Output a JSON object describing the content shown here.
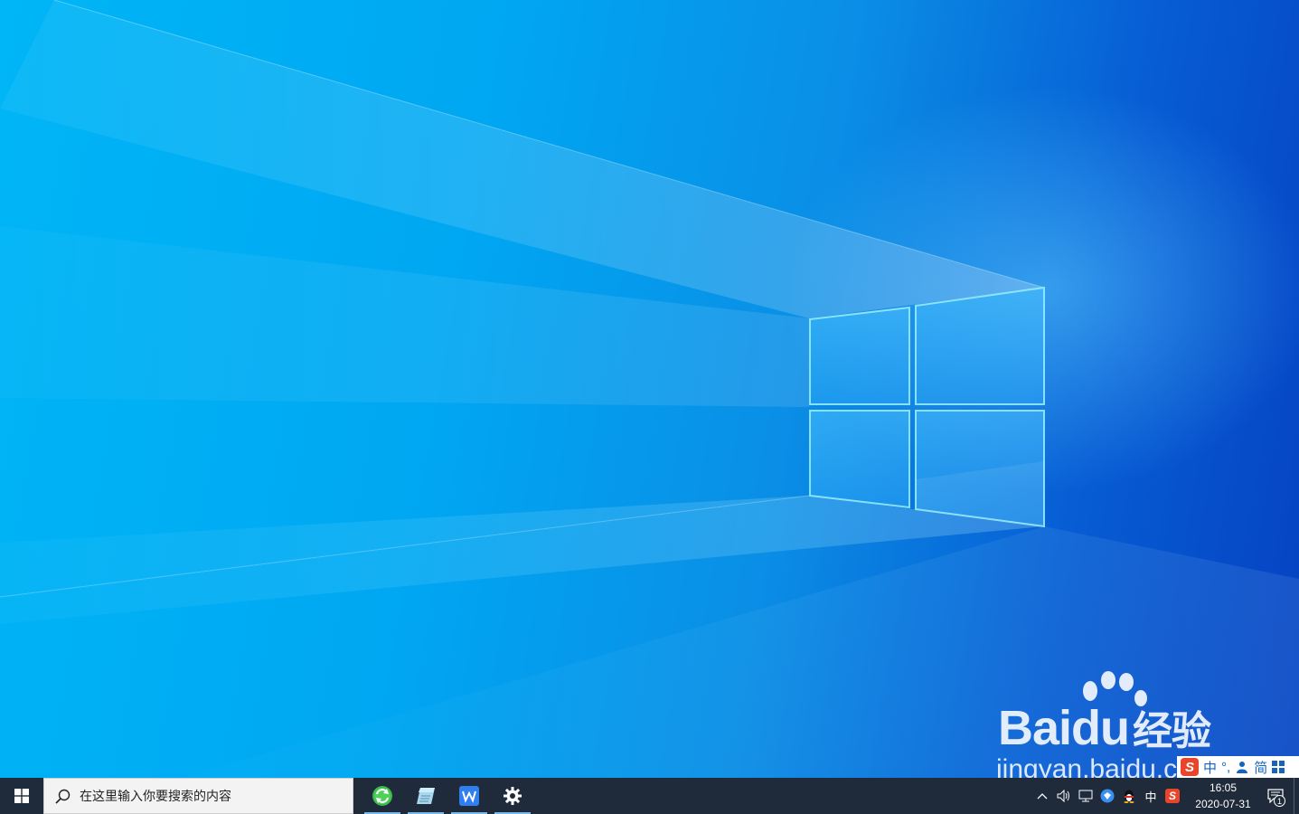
{
  "desktop": {
    "wallpaper": "windows-10-hero-light",
    "accent": "#0a8ee6"
  },
  "watermark": {
    "brand_latin": "Bai",
    "brand_du": "du",
    "brand_cn": "经验",
    "site": "jingyan.baidu.com"
  },
  "ime_bar": {
    "logo": "S",
    "mode": "中",
    "punct": "°,",
    "user_icon": "person-icon",
    "script": "简",
    "grid_icon": "grid-icon"
  },
  "taskbar": {
    "background": "#1f2a3a",
    "start_icon": "windows-logo-icon",
    "search": {
      "placeholder": "在这里输入你要搜索的内容",
      "icon": "search-icon"
    },
    "apps": [
      {
        "name": "360-browser",
        "icon": "green-refresh-icon",
        "running": true
      },
      {
        "name": "notepad",
        "icon": "notepad-icon",
        "running": true
      },
      {
        "name": "wps-office",
        "icon": "wps-icon",
        "running": true
      },
      {
        "name": "settings",
        "icon": "gear-icon",
        "running": true
      }
    ],
    "tray": {
      "ime_label": "中",
      "sogou_label": "S"
    },
    "clock": {
      "time": "16:05",
      "date": "2020-07-31"
    },
    "notifications": {
      "count": "1"
    }
  }
}
